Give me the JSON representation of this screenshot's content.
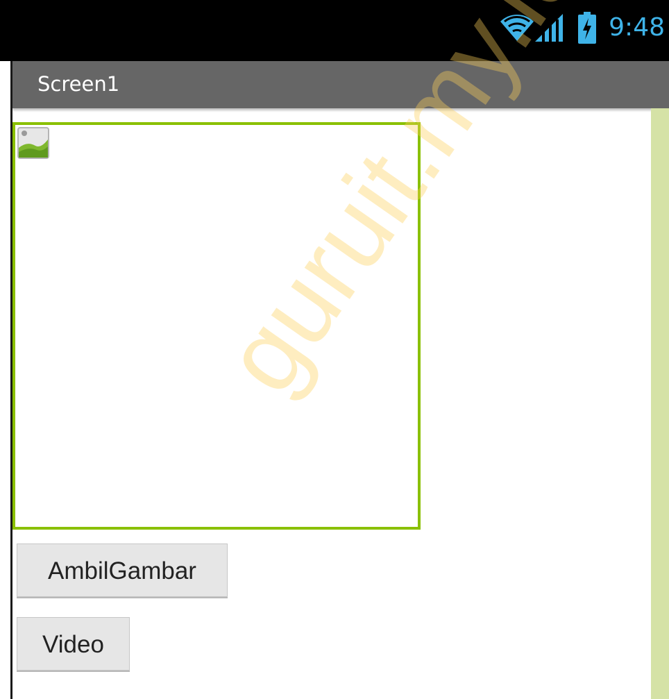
{
  "status_bar": {
    "time": "9:48",
    "icons": [
      "wifi-icon",
      "cell-signal-icon",
      "battery-charging-icon"
    ],
    "accent_color": "#3fb3e8"
  },
  "title_bar": {
    "title": "Screen1"
  },
  "image_component": {
    "icon": "image-placeholder-icon",
    "border_color": "#8ac000"
  },
  "buttons": {
    "ambil_gambar": "AmbilGambar",
    "video": "Video"
  },
  "watermark": {
    "text": "guruit.my.id"
  },
  "colors": {
    "title_bar_bg": "#666666",
    "right_strip": "#d5e2a6"
  }
}
